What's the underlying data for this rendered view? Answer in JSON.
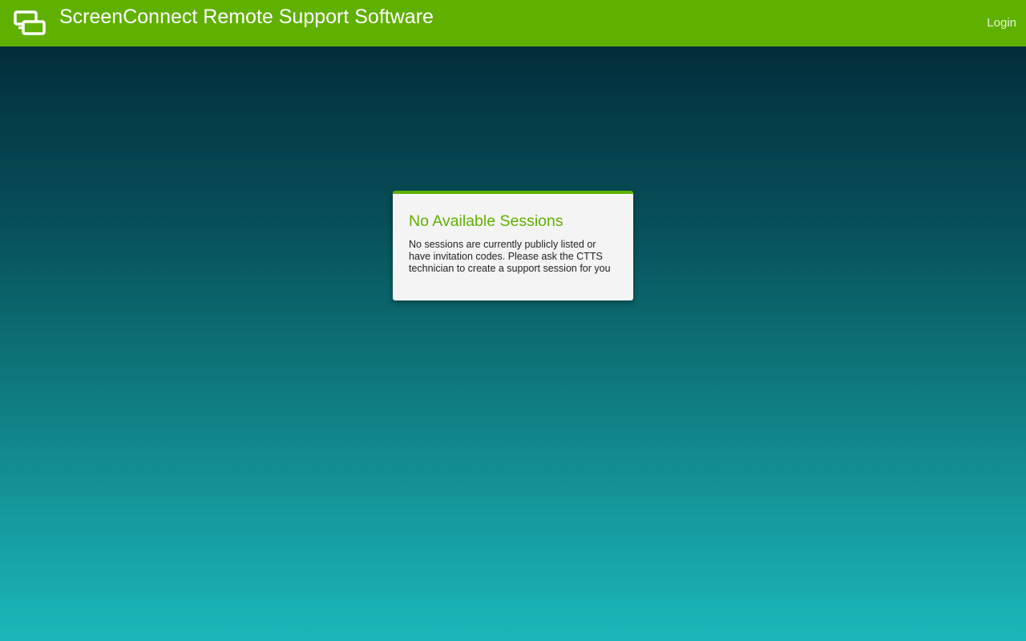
{
  "header": {
    "logo_icon": "screenconnect-logo-icon",
    "title": "ScreenConnect Remote Support Software",
    "login_label": "Login",
    "background_color": "#60b000"
  },
  "main": {
    "card": {
      "title": "No Available Sessions",
      "message": "No sessions are currently publicly listed or have invitation codes. Please ask the CTTS technician to create a support session for you"
    }
  },
  "colors": {
    "accent": "#60b000",
    "background_top": "#00222f",
    "background_bottom": "#1bb7b8"
  }
}
